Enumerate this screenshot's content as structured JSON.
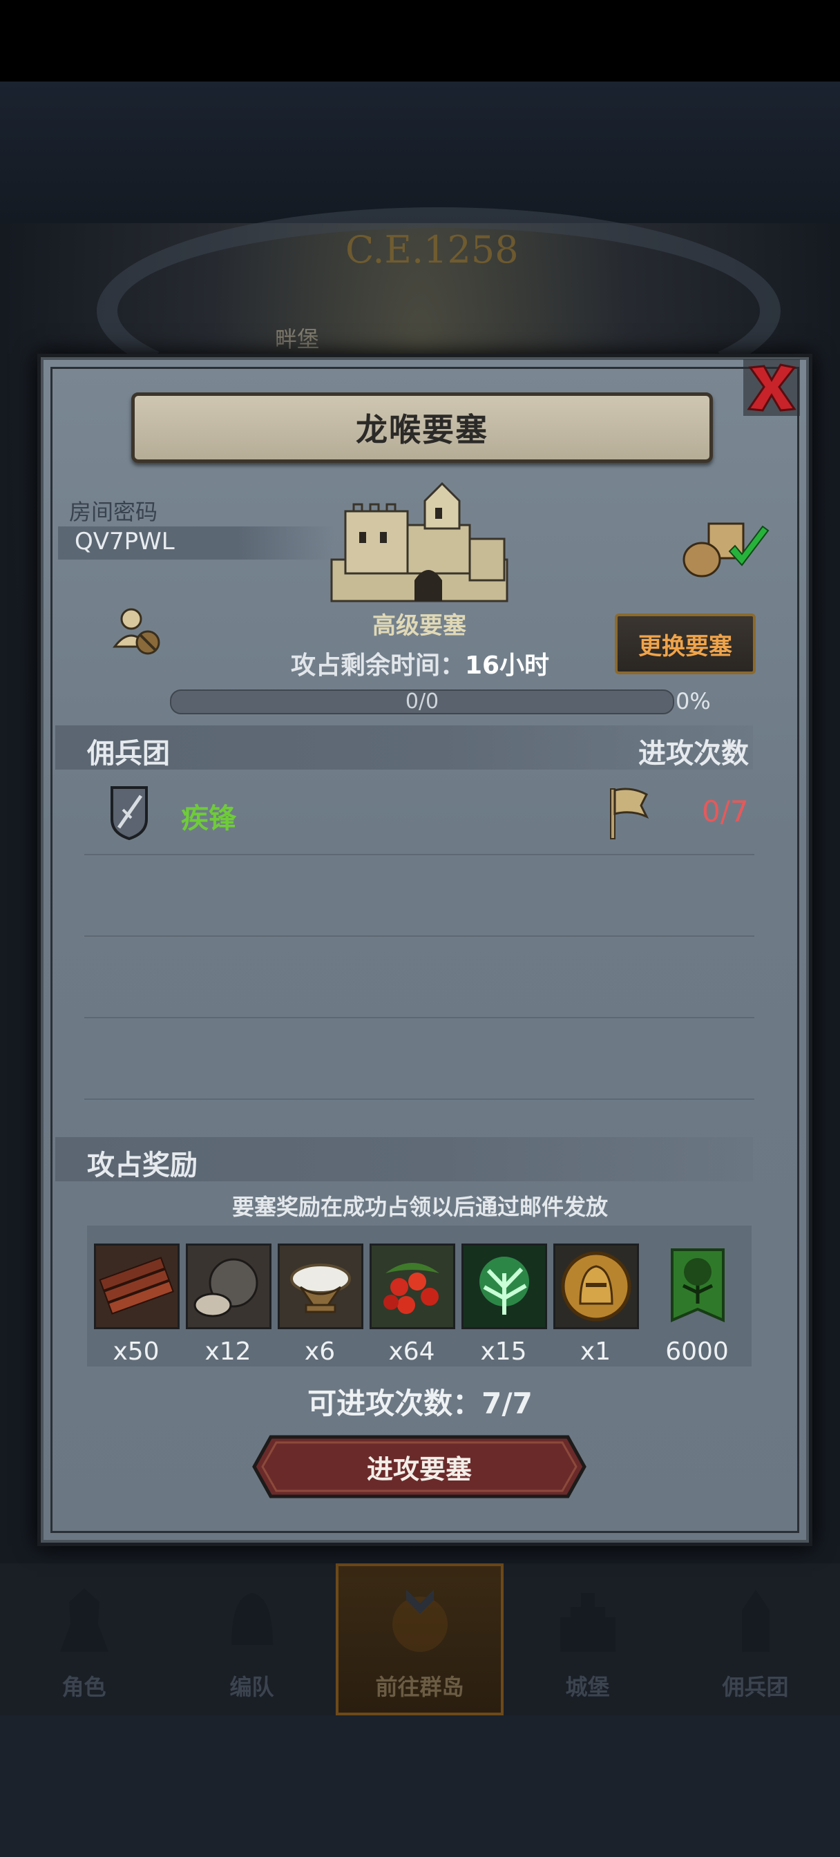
{
  "background": {
    "year": "C.E.1258",
    "castle_label": "畔堡"
  },
  "dialog": {
    "title": "龙喉要塞",
    "room_label": "房间密码",
    "room_code": "QV7PWL",
    "fortress_type": "高级要塞",
    "remaining_time_label": "攻占剩余时间：",
    "remaining_time_value": "16小时",
    "change_button": "更换要塞",
    "progress_text": "0/0",
    "progress_percent_text": "0%",
    "progress_value": 0,
    "mercenary_header": "佣兵团",
    "attack_count_header": "进攻次数",
    "mercenary": {
      "name": "疾锋",
      "attack_count": "0/7"
    },
    "reward_header": "攻占奖励",
    "reward_note": "要塞奖励在成功占领以后通过邮件发放",
    "rewards": [
      {
        "icon": "wood-planks-icon",
        "qty": "x50"
      },
      {
        "icon": "truffle-icon",
        "qty": "x12"
      },
      {
        "icon": "salt-bowl-icon",
        "qty": "x6"
      },
      {
        "icon": "berries-icon",
        "qty": "x64"
      },
      {
        "icon": "green-tree-essence-icon",
        "qty": "x15"
      },
      {
        "icon": "knight-helmet-coin-icon",
        "qty": "x1"
      },
      {
        "icon": "green-tree-banner-icon",
        "qty": "6000"
      }
    ],
    "available_attacks_label": "可进攻次数：",
    "available_attacks_value": "7/7",
    "attack_button": "进攻要塞"
  },
  "bottom_nav": [
    {
      "label": "角色",
      "icon": "knight-icon"
    },
    {
      "label": "编队",
      "icon": "helmet-icon"
    },
    {
      "label": "前往群岛",
      "icon": "globe-icon",
      "active": true
    },
    {
      "label": "城堡",
      "icon": "castle-icon"
    },
    {
      "label": "佣兵团",
      "icon": "mercenary-icon"
    }
  ],
  "colors": {
    "panel": "#6e7b87",
    "mercenary_name": "#6fcc39",
    "attack_count": "#e6595a",
    "change_button_text": "#f0a44a",
    "attack_button": "#6b2a2a"
  }
}
